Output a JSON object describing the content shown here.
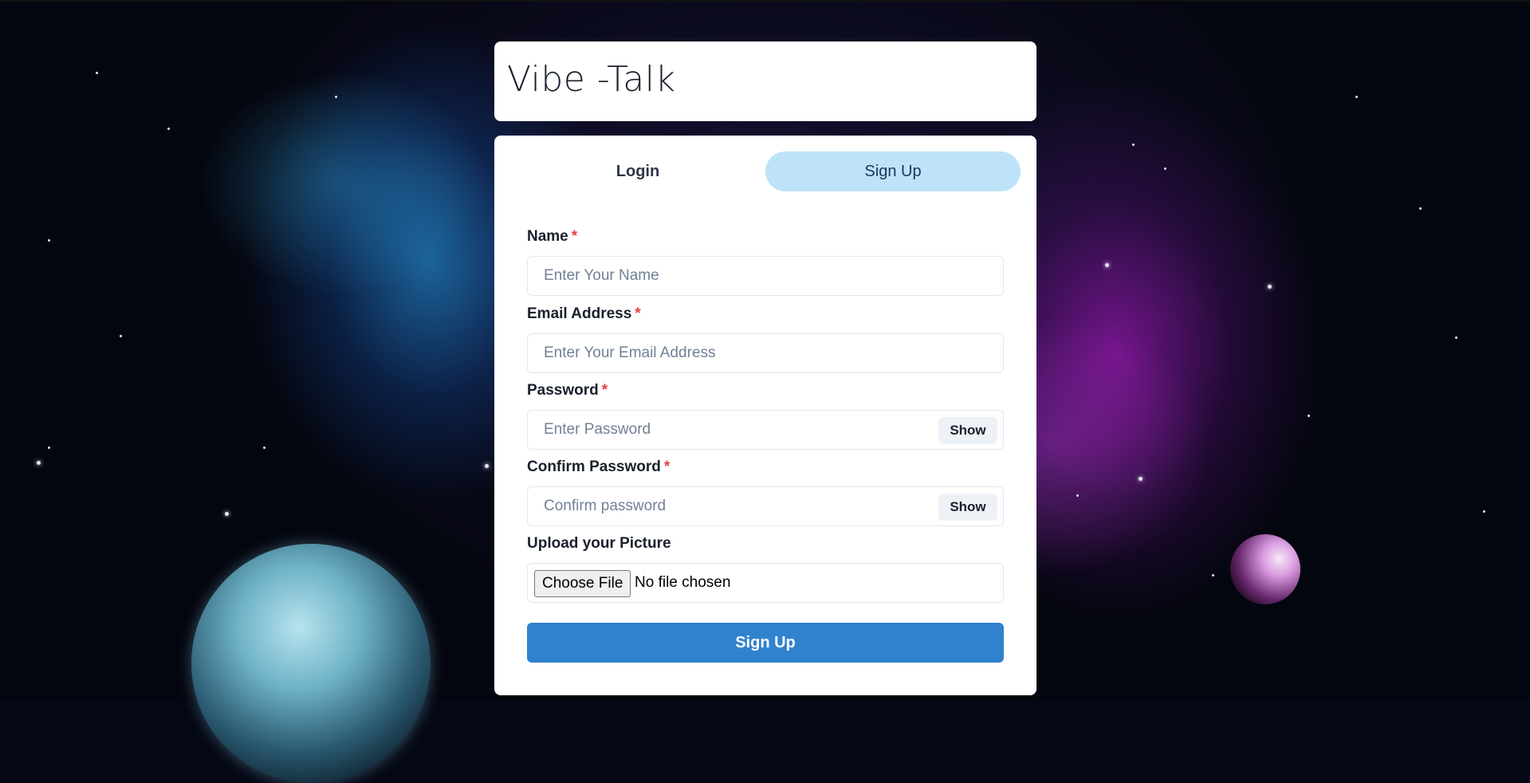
{
  "app": {
    "title": "Vibe -Talk"
  },
  "tabs": [
    {
      "label": "Login",
      "active": false
    },
    {
      "label": "Sign Up",
      "active": true
    }
  ],
  "form": {
    "required_marker": "*",
    "name": {
      "label": "Name",
      "placeholder": "Enter Your Name",
      "value": ""
    },
    "email": {
      "label": "Email Address",
      "placeholder": "Enter Your Email Address",
      "value": ""
    },
    "password": {
      "label": "Password",
      "placeholder": "Enter Password",
      "value": "",
      "toggle_label": "Show"
    },
    "confirm_password": {
      "label": "Confirm Password",
      "placeholder": "Confirm password",
      "value": "",
      "toggle_label": "Show"
    },
    "picture": {
      "label": "Upload your Picture",
      "button_label": "Choose File",
      "status": "No file chosen"
    },
    "submit_label": "Sign Up"
  },
  "colors": {
    "accent": "#3182ce",
    "active_tab": "#bee3f8",
    "required": "#e53e3e"
  }
}
